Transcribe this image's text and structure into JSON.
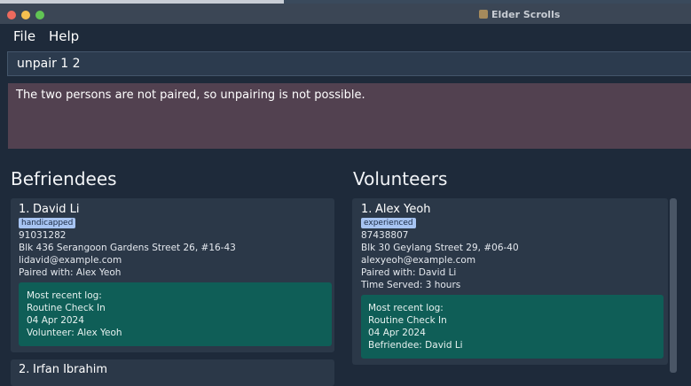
{
  "window": {
    "title": "Elder Scrolls"
  },
  "menu": {
    "file": "File",
    "help": "Help"
  },
  "command": {
    "value": "unpair 1 2"
  },
  "result": {
    "message": "The two persons are not paired, so unpairing is not possible."
  },
  "befriendees": {
    "title": "Befriendees",
    "items": [
      {
        "index": "1.",
        "name": "David Li",
        "tag": "handicapped",
        "phone": "91031282",
        "address": "Blk 436 Serangoon Gardens Street 26, #16-43",
        "email": "lidavid@example.com",
        "paired": "Paired with: Alex Yeoh",
        "log": {
          "header": "Most recent log:",
          "title": "Routine Check In",
          "date": "04 Apr 2024",
          "counterpart": "Volunteer: Alex Yeoh"
        }
      },
      {
        "index": "2.",
        "name": "Irfan Ibrahim"
      }
    ]
  },
  "volunteers": {
    "title": "Volunteers",
    "items": [
      {
        "index": "1.",
        "name": "Alex Yeoh",
        "tag": "experienced",
        "phone": "87438807",
        "address": "Blk 30 Geylang Street 29, #06-40",
        "email": "alexyeoh@example.com",
        "paired": "Paired with: David Li",
        "time_served": "Time Served: 3 hours",
        "log": {
          "header": "Most recent log:",
          "title": "Routine Check In",
          "date": "04 Apr 2024",
          "counterpart": "Befriendee: David Li"
        }
      }
    ]
  },
  "colors": {
    "background": "#1e2a3a",
    "card": "#2b3848",
    "tag": "#a7c4f2",
    "log": "#0f5e57",
    "result": "#524150"
  }
}
